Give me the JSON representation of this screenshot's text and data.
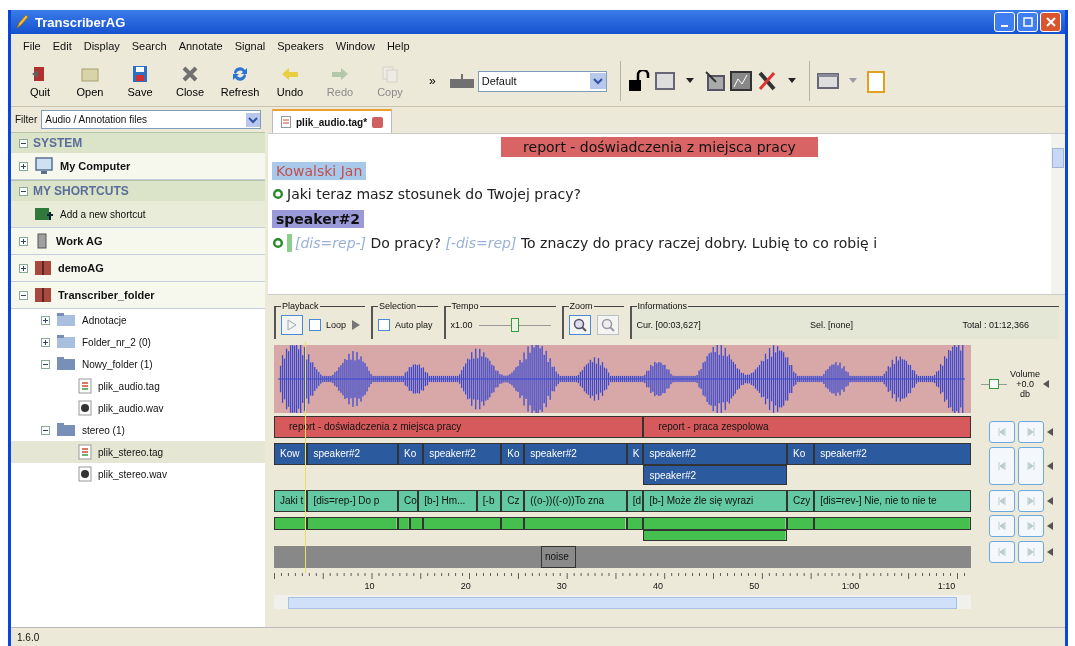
{
  "window": {
    "title": "TranscriberAG"
  },
  "menu": [
    "File",
    "Edit",
    "Display",
    "Search",
    "Annotate",
    "Signal",
    "Speakers",
    "Window",
    "Help"
  ],
  "toolbar": {
    "buttons": [
      {
        "label": "Quit",
        "kind": "quit",
        "disabled": false
      },
      {
        "label": "Open",
        "kind": "open",
        "disabled": false
      },
      {
        "label": "Save",
        "kind": "save",
        "disabled": false
      },
      {
        "label": "Close",
        "kind": "close",
        "disabled": false
      },
      {
        "label": "Refresh",
        "kind": "refresh",
        "disabled": false
      },
      {
        "label": "Undo",
        "kind": "undo",
        "disabled": false
      },
      {
        "label": "Redo",
        "kind": "redo",
        "disabled": true
      },
      {
        "label": "Copy",
        "kind": "copy",
        "disabled": true
      }
    ],
    "overflow": "»",
    "profile": "Default"
  },
  "sidebar": {
    "filter": {
      "label": "Filter",
      "value": "Audio / Annotation files"
    },
    "sections": [
      {
        "title": "SYSTEM",
        "expanded": true,
        "items": [
          {
            "label": "My Computer",
            "kind": "computer",
            "expanded": false,
            "selected": false
          }
        ]
      },
      {
        "title": "MY SHORTCUTS",
        "expanded": true,
        "items": [
          {
            "label": "Add a new shortcut",
            "kind": "add",
            "selected": false
          },
          {
            "label": "Work AG",
            "kind": "network",
            "expanded": false,
            "selected": false
          },
          {
            "label": "demoAG",
            "kind": "book",
            "expanded": false,
            "selected": false
          },
          {
            "label": "Transcriber_folder",
            "kind": "book",
            "expanded": true,
            "selected": false,
            "children": [
              {
                "label": "Adnotacje",
                "kind": "folder",
                "expanded": false,
                "selected": false
              },
              {
                "label": "Folder_nr_2  (0)",
                "kind": "folder",
                "expanded": false,
                "selected": false
              },
              {
                "label": "Nowy_folder  (1)",
                "kind": "folder",
                "expanded": true,
                "selected": false,
                "children": [
                  {
                    "label": "plik_audio.tag",
                    "kind": "tag-file",
                    "selected": false
                  },
                  {
                    "label": "plik_audio.wav",
                    "kind": "wav-file",
                    "selected": false
                  }
                ]
              },
              {
                "label": "stereo  (1)",
                "kind": "folder",
                "expanded": true,
                "selected": false,
                "children": [
                  {
                    "label": "plik_stereo.tag",
                    "kind": "tag-file",
                    "selected": true
                  },
                  {
                    "label": "plik_stereo.wav",
                    "kind": "wav-file",
                    "selected": false
                  }
                ]
              }
            ]
          }
        ]
      }
    ]
  },
  "editor": {
    "tab": {
      "label": "plik_audio.tag*"
    },
    "section": "report - doświadczenia z miejsca pracy",
    "turns": [
      {
        "speaker": "Kowalski Jan",
        "color": "#a9c9ea",
        "lines": [
          [
            {
              "kind": "text",
              "text": "Jaki teraz masz stosunek do Twojej pracy?"
            }
          ]
        ]
      },
      {
        "speaker": "speaker#2",
        "color": "#9b9ad8",
        "lines": [
          [
            {
              "kind": "tag",
              "text": "[dis=rep-]"
            },
            {
              "kind": "text",
              "text": "Do pracy?"
            },
            {
              "kind": "tag",
              "text": "[-dis=rep]"
            },
            {
              "kind": "text",
              "text": "To znaczy do pracy raczej dobry. Lubię to co robię i"
            }
          ]
        ]
      }
    ]
  },
  "controls": {
    "playback": {
      "label": "Playback",
      "loop": {
        "label": "Loop",
        "checked": false
      }
    },
    "selection": {
      "label": "Selection",
      "autoplay": {
        "label": "Auto play",
        "checked": false
      }
    },
    "tempo": {
      "label": "Tempo",
      "value": "x1.00",
      "level": 0.5
    },
    "zoom": {
      "label": "Zoom",
      "zoom_in_active": true
    },
    "info": {
      "label": "Informations",
      "cur": "Cur. [00:03,627]",
      "sel": "Sel. [none]",
      "total": "Total : 01:12,366"
    }
  },
  "volume": {
    "level": 0.5,
    "label": "Volume",
    "value": "+0.0",
    "unit": "db"
  },
  "tracks": [
    {
      "kind": "topic",
      "segments": [
        {
          "text": "report - doświadczenia z miejsca pracy"
        },
        {
          "text": "report - praca zespolowa"
        }
      ]
    },
    {
      "kind": "speaker",
      "segments": [
        {
          "text": "Kow"
        },
        {
          "text": "speaker#2"
        },
        {
          "text": "Ko"
        },
        {
          "text": "speaker#2"
        },
        {
          "text": "Ko"
        },
        {
          "text": "speaker#2"
        },
        {
          "text": "K"
        },
        {
          "text": "speaker#2"
        },
        {
          "text": "Ko"
        },
        {
          "text": "speaker#2"
        }
      ]
    },
    {
      "kind": "speaker",
      "segments": [
        {
          "text": "speaker#2"
        }
      ]
    },
    {
      "kind": "text",
      "segments": [
        {
          "text": "Jaki t"
        },
        {
          "text": "[dis=rep-] Do p"
        },
        {
          "text": "Co"
        },
        {
          "text": "[b-] Hm..."
        },
        {
          "text": "[-b"
        },
        {
          "text": "Cz"
        },
        {
          "text": "((o-))((-o))To zna"
        },
        {
          "text": "[d"
        },
        {
          "text": "[b-] Może źle się wyrazi"
        },
        {
          "text": "Czy"
        },
        {
          "text": "[dis=rev-] Nie, nie to nie te"
        }
      ]
    },
    {
      "kind": "green"
    },
    {
      "kind": "green"
    },
    {
      "kind": "noise",
      "segments": [
        {
          "text": "noise"
        }
      ]
    }
  ],
  "ruler": [
    "10",
    "20",
    "30",
    "40",
    "50",
    "1:00",
    "1:10"
  ],
  "status_bar": "1.6.0"
}
